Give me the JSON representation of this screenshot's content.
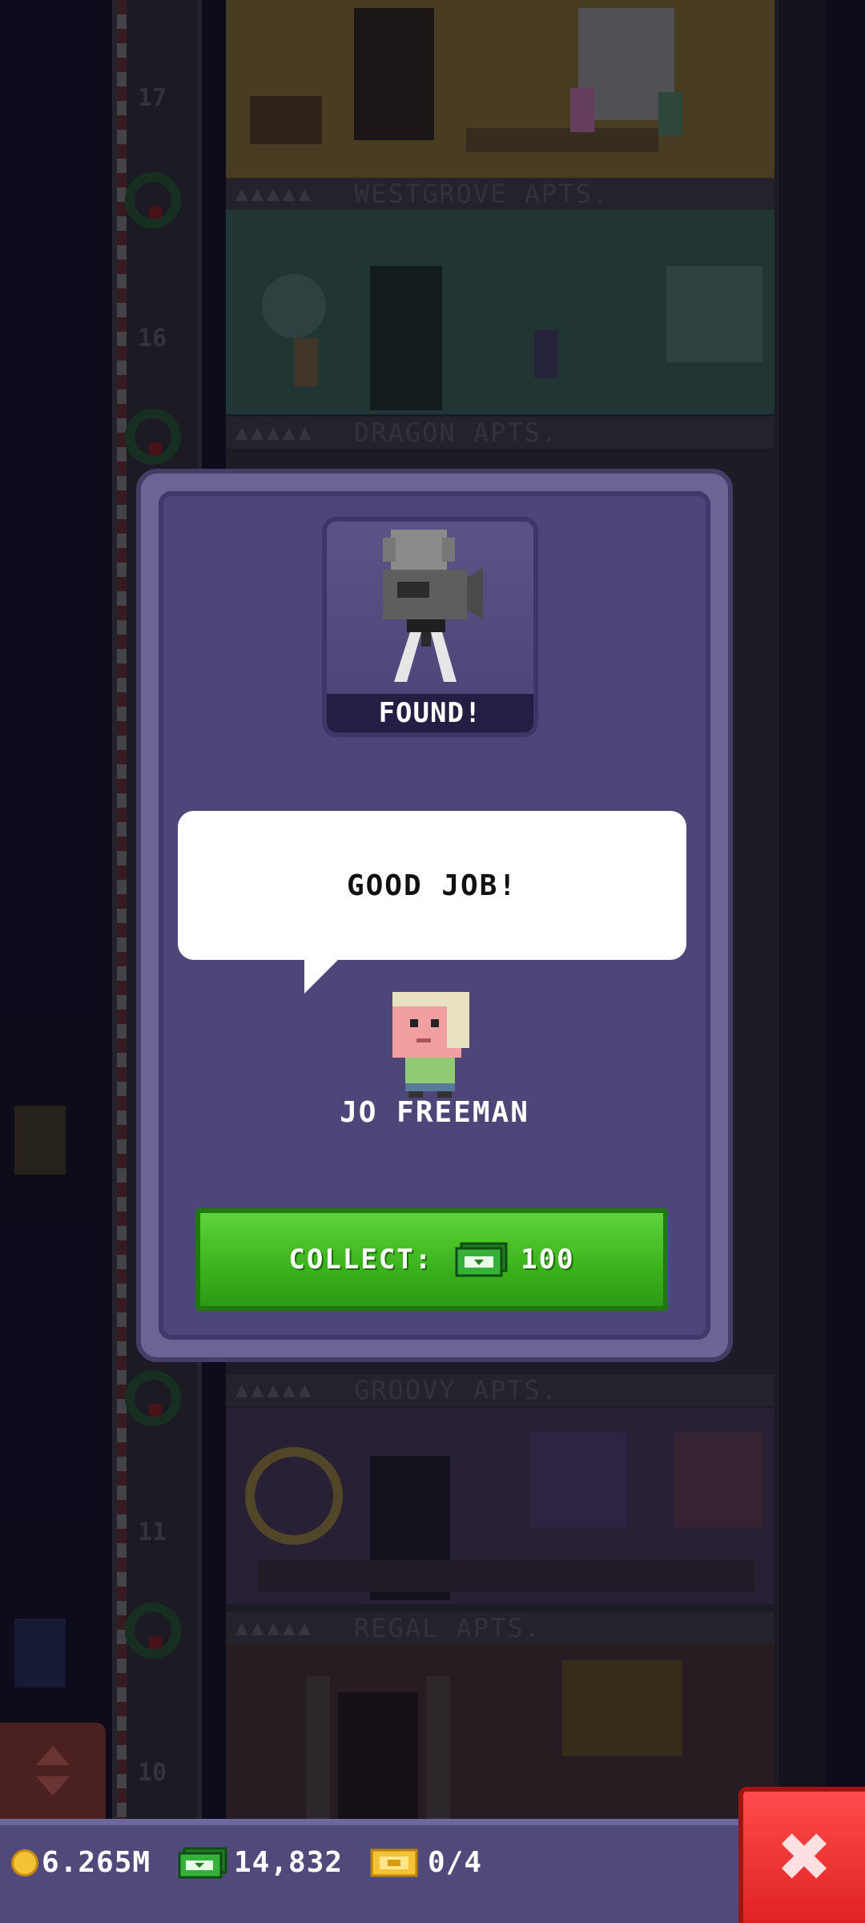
{
  "tower": {
    "floors": [
      {
        "number": "17",
        "name": "WESTGROVE APTS.",
        "color": "#6c5a2a"
      },
      {
        "number": "16",
        "name": "DRAGON APTS.",
        "color": "#2f5549"
      },
      {
        "number": "11",
        "name": "GROOVY APTS.",
        "color": "#3a2f4a"
      },
      {
        "number": "10",
        "name": "REGAL APTS.",
        "color": "#3d2a2a"
      }
    ],
    "sign_dots": "▲▲▲▲▲"
  },
  "popup": {
    "item_status": "FOUND!",
    "item_icon": "movie-camera-icon",
    "speech": "GOOD JOB!",
    "npc_name": "JO FREEMAN",
    "collect": {
      "label": "COLLECT:",
      "currency_icon": "bux-icon",
      "amount": "100"
    }
  },
  "hud": {
    "coins": "6.265M",
    "bux": "14,832",
    "tickets": "0/4",
    "close_icon": "close-icon"
  },
  "colors": {
    "popup_frame": "#6b6596",
    "popup_inner": "#4c4778",
    "collect_green": "#3ab21c",
    "close_red": "#e02222",
    "hud_bar": "#4f4a7a"
  }
}
